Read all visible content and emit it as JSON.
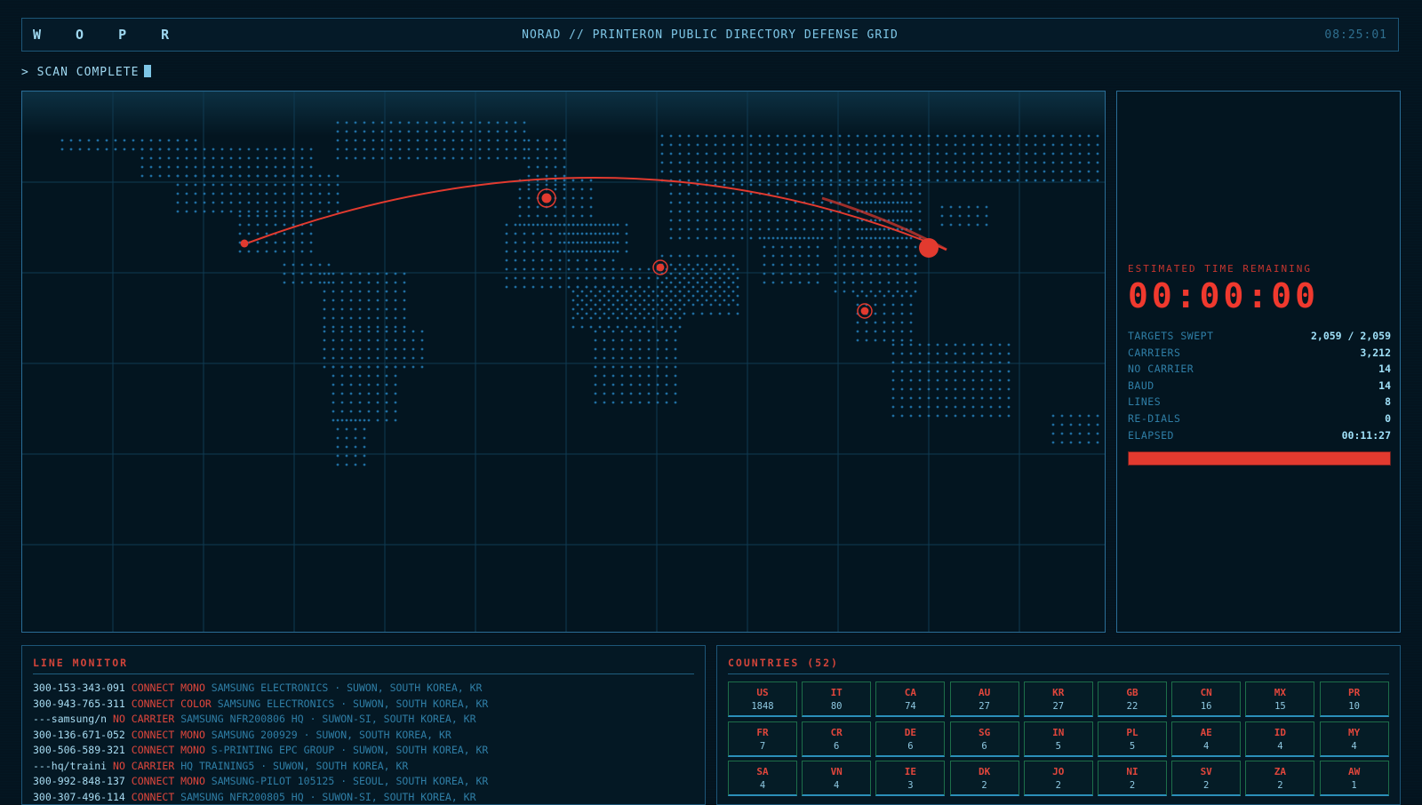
{
  "app": {
    "brand": "W O P R",
    "headline": "NORAD // PRINTERON PUBLIC DIRECTORY DEFENSE GRID",
    "clock": "08:25:01"
  },
  "status_line": "> SCAN COMPLETE",
  "map": {
    "colors": {
      "land_dots": "#1f6da0",
      "grid": "#0f3a52",
      "arc": "#e23a2f",
      "target": "#e23a2f"
    }
  },
  "stats": {
    "etr_label": "ESTIMATED TIME REMAINING",
    "etr_value": "00:00:00",
    "rows": [
      {
        "label": "TARGETS SWEPT",
        "value": "2,059 / 2,059"
      },
      {
        "label": "CARRIERS",
        "value": "3,212"
      },
      {
        "label": "NO CARRIER",
        "value": "14"
      },
      {
        "label": "BAUD",
        "value": "14"
      },
      {
        "label": "LINES",
        "value": "8"
      },
      {
        "label": "RE-DIALS",
        "value": "0"
      },
      {
        "label": "ELAPSED",
        "value": "00:11:27"
      }
    ],
    "progress": 1.0
  },
  "line_monitor": {
    "title": "LINE MONITOR",
    "lines": [
      {
        "number": "300-153-343-091",
        "status": "CONNECT",
        "type": "MONO",
        "detail": "SAMSUNG ELECTRONICS · SUWON, SOUTH KOREA, KR"
      },
      {
        "number": "300-943-765-311",
        "status": "CONNECT",
        "type": "COLOR",
        "detail": "SAMSUNG ELECTRONICS · SUWON, SOUTH KOREA, KR"
      },
      {
        "number": "---samsung/n",
        "status": "NO CARRIER",
        "type": "",
        "detail": "SAMSUNG NFR200806 HQ · SUWON-SI, SOUTH KOREA, KR"
      },
      {
        "number": "300-136-671-052",
        "status": "CONNECT",
        "type": "MONO",
        "detail": "SAMSUNG 200929 · SUWON, SOUTH KOREA, KR"
      },
      {
        "number": "300-506-589-321",
        "status": "CONNECT",
        "type": "MONO",
        "detail": "S-PRINTING EPC GROUP · SUWON, SOUTH KOREA, KR"
      },
      {
        "number": "---hq/traini",
        "status": "NO CARRIER",
        "type": "",
        "detail": "HQ TRAINING5 · SUWON, SOUTH KOREA, KR"
      },
      {
        "number": "300-992-848-137",
        "status": "CONNECT",
        "type": "MONO",
        "detail": "SAMSUNG-PILOT 105125 · SEOUL, SOUTH KOREA, KR"
      },
      {
        "number": "300-307-496-114",
        "status": "CONNECT",
        "type": "",
        "detail": "SAMSUNG NFR200805 HQ · SUWON-SI, SOUTH KOREA, KR"
      }
    ]
  },
  "countries": {
    "title": "COUNTRIES (52)",
    "items": [
      {
        "code": "US",
        "count": "1848"
      },
      {
        "code": "IT",
        "count": "80"
      },
      {
        "code": "CA",
        "count": "74"
      },
      {
        "code": "AU",
        "count": "27"
      },
      {
        "code": "KR",
        "count": "27"
      },
      {
        "code": "GB",
        "count": "22"
      },
      {
        "code": "CN",
        "count": "16"
      },
      {
        "code": "MX",
        "count": "15"
      },
      {
        "code": "PR",
        "count": "10"
      },
      {
        "code": "FR",
        "count": "7"
      },
      {
        "code": "CR",
        "count": "6"
      },
      {
        "code": "DE",
        "count": "6"
      },
      {
        "code": "SG",
        "count": "6"
      },
      {
        "code": "IN",
        "count": "5"
      },
      {
        "code": "PL",
        "count": "5"
      },
      {
        "code": "AE",
        "count": "4"
      },
      {
        "code": "ID",
        "count": "4"
      },
      {
        "code": "MY",
        "count": "4"
      },
      {
        "code": "SA",
        "count": "4"
      },
      {
        "code": "VN",
        "count": "4"
      },
      {
        "code": "IE",
        "count": "3"
      },
      {
        "code": "DK",
        "count": "2"
      },
      {
        "code": "JO",
        "count": "2"
      },
      {
        "code": "NI",
        "count": "2"
      },
      {
        "code": "SV",
        "count": "2"
      },
      {
        "code": "ZA",
        "count": "2"
      },
      {
        "code": "AW",
        "count": "1"
      }
    ]
  }
}
